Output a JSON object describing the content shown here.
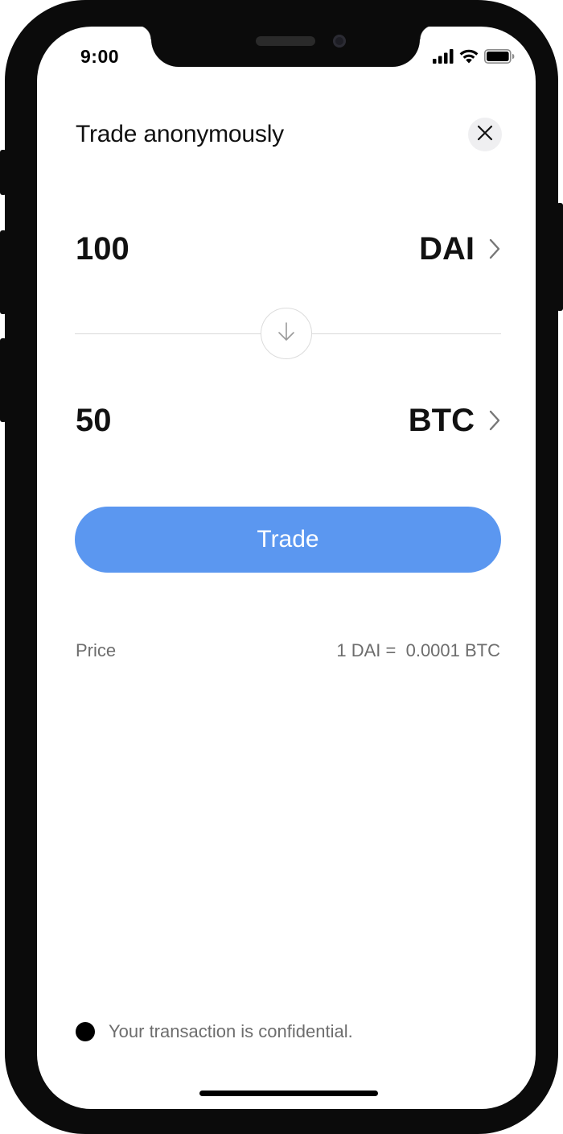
{
  "status_bar": {
    "time": "9:00",
    "icons": [
      "cellular-signal-icon",
      "wifi-icon",
      "battery-icon"
    ]
  },
  "header": {
    "title": "Trade anonymously",
    "close_icon": "close-icon"
  },
  "from": {
    "amount": "100",
    "token": "DAI"
  },
  "to": {
    "amount": "50",
    "token": "BTC"
  },
  "swap_icon": "arrow-down-icon",
  "trade_button": {
    "label": "Trade"
  },
  "price": {
    "label": "Price",
    "value": "1 DAI =  0.0001 BTC"
  },
  "footer": {
    "note": "Your transaction is confidential."
  },
  "colors": {
    "accent": "#5b97f0",
    "text": "#111111",
    "muted": "#6d6d6d",
    "frame": "#0b0b0b"
  }
}
